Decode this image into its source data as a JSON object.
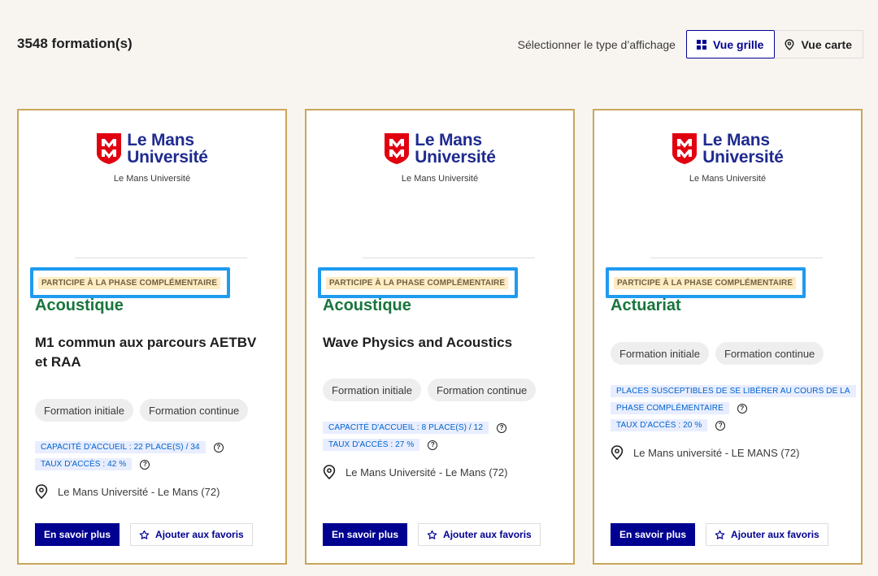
{
  "results": {
    "count_label": "3548 formation(s)"
  },
  "view_selector": {
    "label": "Sélectionner le type d’affichage",
    "grid_label": "Vue grille",
    "map_label": "Vue carte"
  },
  "colors": {
    "accent": "#000091",
    "card_border": "#c8a65a",
    "domain": "#18753c",
    "highlight": "#1f9bef"
  },
  "cards": [
    {
      "logo_line1": "Le Mans",
      "logo_line2": "Université",
      "institution": "Le Mans Université",
      "phase_badge": "PARTICIPE À LA PHASE COMPLÉMENTAIRE",
      "domain": "Acoustique",
      "title": "M1 commun aux parcours AETBV et RAA",
      "tags": [
        "Formation initiale",
        "Formation continue"
      ],
      "info": [
        "CAPACITÉ D'ACCUEIL : 22 PLACE(S) / 34",
        "TAUX D'ACCÈS : 42 %"
      ],
      "location": "Le Mans Université - Le Mans (72)",
      "primary_button": "En savoir plus",
      "secondary_button": "Ajouter aux favoris"
    },
    {
      "logo_line1": "Le Mans",
      "logo_line2": "Université",
      "institution": "Le Mans Université",
      "phase_badge": "PARTICIPE À LA PHASE COMPLÉMENTAIRE",
      "domain": "Acoustique",
      "title": "Wave Physics and Acoustics",
      "tags": [
        "Formation initiale",
        "Formation continue"
      ],
      "info": [
        "CAPACITÉ D'ACCUEIL : 8 PLACE(S) / 12",
        "TAUX D'ACCÈS : 27 %"
      ],
      "location": "Le Mans Université - Le Mans (72)",
      "primary_button": "En savoir plus",
      "secondary_button": "Ajouter aux favoris"
    },
    {
      "logo_line1": "Le Mans",
      "logo_line2": "Université",
      "institution": "Le Mans Université",
      "phase_badge": "PARTICIPE À LA PHASE COMPLÉMENTAIRE",
      "domain": "Actuariat",
      "title": "",
      "tags": [
        "Formation initiale",
        "Formation continue"
      ],
      "info_line1a": "PLACES SUSCEPTIBLES DE SE LIBÉRER AU COURS DE LA",
      "info_line1b": "PHASE COMPLÉMENTAIRE",
      "info": [
        "TAUX D'ACCÈS : 20 %"
      ],
      "location": "Le Mans université - LE MANS (72)",
      "primary_button": "En savoir plus",
      "secondary_button": "Ajouter aux favoris"
    }
  ]
}
